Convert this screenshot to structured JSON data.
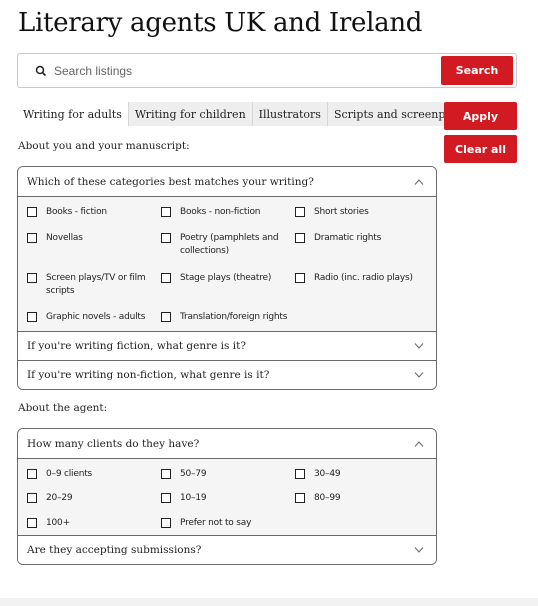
{
  "page": {
    "title": "Literary agents UK and Ireland"
  },
  "search": {
    "placeholder": "Search listings",
    "value": "",
    "button_label": "Search",
    "icon": "search-icon"
  },
  "tabs": [
    {
      "label": "Writing for adults",
      "active": true
    },
    {
      "label": "Writing for children",
      "active": false
    },
    {
      "label": "Illustrators",
      "active": false
    },
    {
      "label": "Scripts and screenplays",
      "active": false
    }
  ],
  "actions": {
    "apply_label": "Apply",
    "clear_label": "Clear all"
  },
  "colors": {
    "accent": "#d21a22"
  },
  "sections": {
    "manuscript": {
      "label": "About you and your manuscript:",
      "accordions": [
        {
          "title": "Which of these categories best matches your writing?",
          "expanded": true,
          "options": [
            {
              "label": "Books - fiction",
              "checked": false
            },
            {
              "label": "Books - non-fiction",
              "checked": false
            },
            {
              "label": "Short stories",
              "checked": false
            },
            {
              "label": "Novellas",
              "checked": false
            },
            {
              "label": "Poetry (pamphlets and collections)",
              "checked": false
            },
            {
              "label": "Dramatic rights",
              "checked": false
            },
            {
              "label": "Screen plays/TV or film scripts",
              "checked": false
            },
            {
              "label": "Stage plays (theatre)",
              "checked": false
            },
            {
              "label": "Radio (inc. radio plays)",
              "checked": false
            },
            {
              "label": "Graphic novels - adults",
              "checked": false
            },
            {
              "label": "Translation/foreign rights",
              "checked": false
            }
          ]
        },
        {
          "title": "If you're writing fiction, what genre is it?",
          "expanded": false
        },
        {
          "title": "If you're writing non-fiction, what genre is it?",
          "expanded": false
        }
      ]
    },
    "agent": {
      "label": "About the agent:",
      "accordions": [
        {
          "title": "How many clients do they have?",
          "expanded": true,
          "options": [
            {
              "label": "0–9 clients",
              "checked": false
            },
            {
              "label": "50–79",
              "checked": false
            },
            {
              "label": "30–49",
              "checked": false
            },
            {
              "label": "20–29",
              "checked": false
            },
            {
              "label": "10–19",
              "checked": false
            },
            {
              "label": "80–99",
              "checked": false
            },
            {
              "label": "100+",
              "checked": false
            },
            {
              "label": "Prefer not to say",
              "checked": false
            }
          ]
        },
        {
          "title": "Are they accepting submissions?",
          "expanded": false
        }
      ]
    }
  }
}
